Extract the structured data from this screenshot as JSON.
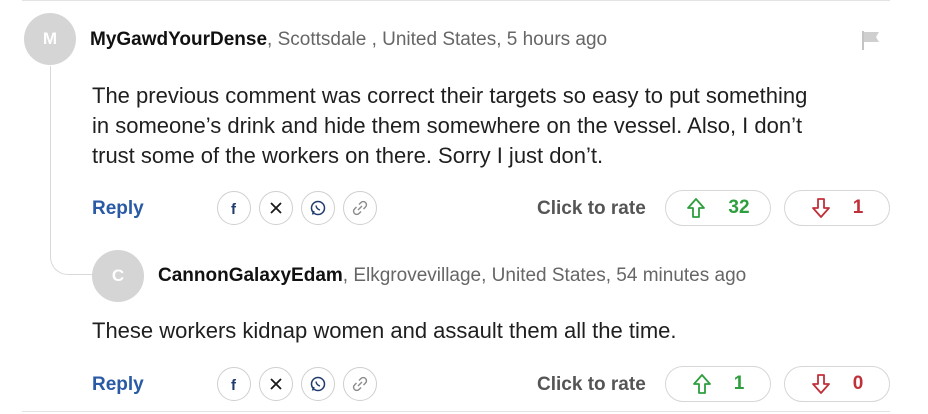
{
  "comments": [
    {
      "avatar_initial": "M",
      "username": "MyGawdYourDense",
      "meta": ", Scottsdale , United States, 5 hours ago",
      "body_lines": [
        "The previous comment was correct their targets so easy to put something",
        "in someone’s drink and hide them somewhere on the vessel. Also, I don’t",
        "trust some of the workers on there. Sorry I just don’t."
      ],
      "reply_label": "Reply",
      "rate_label": "Click to rate",
      "upvotes": "32",
      "downvotes": "1"
    },
    {
      "avatar_initial": "C",
      "username": "CannonGalaxyEdam",
      "meta": ", Elkgrovevillage, United States, 54 minutes ago",
      "body_lines": [
        "These workers kidnap women and assault them all the time."
      ],
      "reply_label": "Reply",
      "rate_label": "Click to rate",
      "upvotes": "1",
      "downvotes": "0"
    }
  ],
  "colors": {
    "upvote": "#2e9e3e",
    "downvote": "#c0303a",
    "reply": "#2a5aa6",
    "avatar": "#d5d5d5"
  },
  "icons": [
    "flag-icon",
    "facebook-icon",
    "x-icon",
    "whatsapp-icon",
    "link-icon",
    "thumb-up-icon",
    "thumb-down-icon"
  ]
}
